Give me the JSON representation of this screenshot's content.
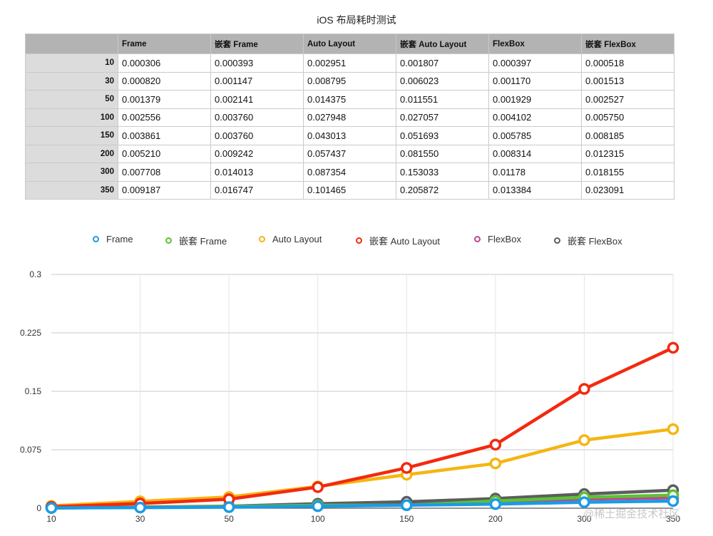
{
  "title": "iOS 布局耗时测试",
  "table": {
    "columns": [
      "Frame",
      "嵌套 Frame",
      "Auto Layout",
      "嵌套 Auto Layout",
      "FlexBox",
      "嵌套 FlexBox"
    ],
    "rows": [
      {
        "label": "10",
        "cells": [
          "0.000306",
          "0.000393",
          "0.002951",
          "0.001807",
          "0.000397",
          "0.000518"
        ]
      },
      {
        "label": "30",
        "cells": [
          "0.000820",
          "0.001147",
          "0.008795",
          "0.006023",
          "0.001170",
          "0.001513"
        ]
      },
      {
        "label": "50",
        "cells": [
          "0.001379",
          "0.002141",
          "0.014375",
          "0.011551",
          "0.001929",
          "0.002527"
        ]
      },
      {
        "label": "100",
        "cells": [
          "0.002556",
          "0.003760",
          "0.027948",
          "0.027057",
          "0.004102",
          "0.005750"
        ]
      },
      {
        "label": "150",
        "cells": [
          "0.003861",
          "0.003760",
          "0.043013",
          "0.051693",
          "0.005785",
          "0.008185"
        ]
      },
      {
        "label": "200",
        "cells": [
          "0.005210",
          "0.009242",
          "0.057437",
          "0.081550",
          "0.008314",
          "0.012315"
        ]
      },
      {
        "label": "300",
        "cells": [
          "0.007708",
          "0.014013",
          "0.087354",
          "0.153033",
          "0.01178",
          "0.018155"
        ]
      },
      {
        "label": "350",
        "cells": [
          "0.009187",
          "0.016747",
          "0.101465",
          "0.205872",
          "0.013384",
          "0.023091"
        ]
      }
    ]
  },
  "watermark": "@稀土掘金技术社区",
  "chart_data": {
    "type": "line",
    "categories": [
      "10",
      "30",
      "50",
      "100",
      "150",
      "200",
      "300",
      "350"
    ],
    "ylim": [
      0,
      0.3
    ],
    "yticks": [
      "0",
      "0.075",
      "0.15",
      "0.225",
      "0.3"
    ],
    "ytick_values": [
      0,
      0.075,
      0.15,
      0.225,
      0.3
    ],
    "grid": true,
    "legend_position": "top",
    "series": [
      {
        "name": "Frame",
        "color": "#1a9be6",
        "values": [
          0.000306,
          0.00082,
          0.001379,
          0.002556,
          0.003861,
          0.00521,
          0.007708,
          0.009187
        ]
      },
      {
        "name": "嵌套 Frame",
        "color": "#5bc236",
        "values": [
          0.000393,
          0.001147,
          0.002141,
          0.00376,
          0.00376,
          0.009242,
          0.014013,
          0.016747
        ]
      },
      {
        "name": "Auto Layout",
        "color": "#f5b512",
        "values": [
          0.002951,
          0.008795,
          0.014375,
          0.027948,
          0.043013,
          0.057437,
          0.087354,
          0.101465
        ]
      },
      {
        "name": "嵌套 Auto Layout",
        "color": "#f22a0f",
        "values": [
          0.001807,
          0.006023,
          0.011551,
          0.027057,
          0.051693,
          0.08155,
          0.153033,
          0.205872
        ]
      },
      {
        "name": "FlexBox",
        "color": "#c0468e",
        "values": [
          0.000397,
          0.00117,
          0.001929,
          0.004102,
          0.005785,
          0.008314,
          0.01178,
          0.013384
        ]
      },
      {
        "name": "嵌套 FlexBox",
        "color": "#5d5d5d",
        "values": [
          0.000518,
          0.001513,
          0.002527,
          0.00575,
          0.008185,
          0.012315,
          0.018155,
          0.023091
        ]
      }
    ]
  }
}
